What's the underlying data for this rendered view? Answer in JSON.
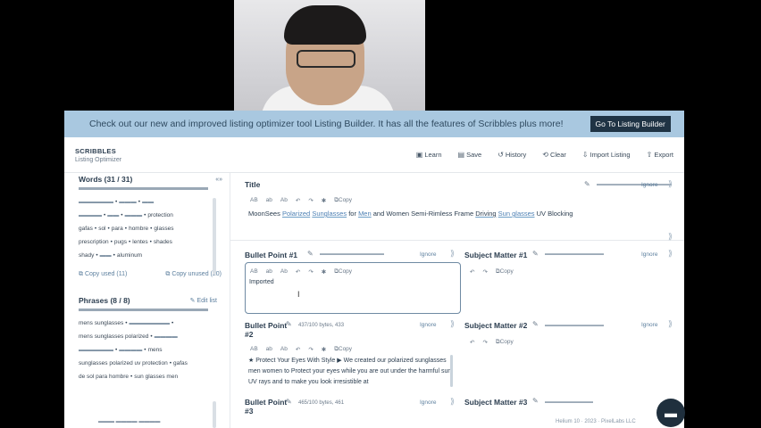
{
  "banner": {
    "text": "Check out our new and improved listing optimizer tool Listing Builder. It has all the features of Scribbles plus more!",
    "button": "Go To Listing Builder"
  },
  "brand": {
    "name": "SCRIBBLES",
    "subtitle": "Listing Optimizer"
  },
  "toolbar": [
    {
      "icon": "learn-icon",
      "glyph": "▣",
      "label": "Learn"
    },
    {
      "icon": "save-icon",
      "glyph": "▤",
      "label": "Save"
    },
    {
      "icon": "history-icon",
      "glyph": "↺",
      "label": "History"
    },
    {
      "icon": "clear-icon",
      "glyph": "⟲",
      "label": "Clear"
    },
    {
      "icon": "import-icon",
      "glyph": "⇩",
      "label": "Import Listing"
    },
    {
      "icon": "export-icon",
      "glyph": "⇧",
      "label": "Export"
    }
  ],
  "words": {
    "heading": "Words (31 / 31)",
    "chips": [
      "prescription",
      "pugs",
      "lentes",
      "shades",
      "shady",
      "aluminum"
    ],
    "chips_row2": [
      "gafas",
      "sol",
      "para",
      "hombre",
      "glasses"
    ],
    "protection": "protection",
    "copy_used": "Copy used (11)",
    "copy_unused": "Copy unused (20)"
  },
  "phrases": {
    "heading": "Phrases (8 / 8)",
    "edit": "Edit list",
    "items": [
      "mens sunglasses",
      "mens sunglasses polarized",
      "mens",
      "sunglasses polarized uv protection",
      "gafas",
      "de sol para hombre",
      "sun glasses men"
    ]
  },
  "fields": {
    "title_label": "Title",
    "ignore": "Ignore",
    "copy": "Copy",
    "title_text": {
      "a": "MoonSees",
      "b": "Polarized",
      "c": "Sunglasses",
      "d": "for",
      "e": "Men",
      "f": "and Women Semi-Rimless Frame",
      "g": "Driving",
      "h": "Sun glasses",
      "i": "UV Blocking"
    },
    "bp1_label": "Bullet Point #1",
    "bp1_value": "Imported",
    "sm1_label": "Subject Matter #1",
    "bp2_label_a": "Bullet Point",
    "bp2_label_b": "#2",
    "bp2_meta": "437/100 bytes, 433",
    "sm2_label": "Subject Matter #2",
    "bp2_text": "★ Protect Your Eyes With Style ▶ We created our polarized sunglasses men women to Protect your eyes while you are out under the harmful sun UV rays and to make you look irresistible at",
    "bp3_label_a": "Bullet Point",
    "bp3_label_b": "#3",
    "bp3_meta": "465/100 bytes, 461",
    "sm3_label": "Subject Matter #3"
  },
  "mini_tools": [
    "AB",
    "ab",
    "Ab",
    "↶",
    "↷",
    "✱"
  ],
  "footer": {
    "right": "Helium 10 · 2023 · PixelLabs LLC"
  }
}
